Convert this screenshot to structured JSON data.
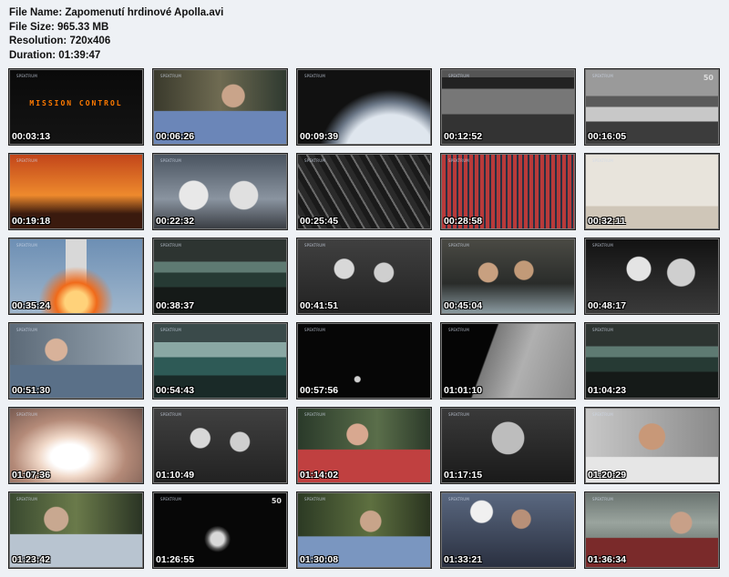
{
  "info": {
    "file_name": "File Name: Zapomenutí hrdinové Apolla.avi",
    "file_size": "File Size: 965.33 MB",
    "resolution": "Resolution: 720x406",
    "duration": "Duration: 01:39:47"
  },
  "channel_logo": "SPEKTRUM",
  "thumbnails": [
    {
      "time": "00:03:13",
      "scene": "title-mission-control",
      "overlay": "MISSION CONTROL"
    },
    {
      "time": "00:06:26",
      "scene": "interview-man-blue"
    },
    {
      "time": "00:09:39",
      "scene": "space-earth"
    },
    {
      "time": "00:12:52",
      "scene": "console-closeup"
    },
    {
      "time": "00:16:05",
      "scene": "control-room-bw",
      "badge": "50"
    },
    {
      "time": "00:19:18",
      "scene": "sunset-subtitle"
    },
    {
      "time": "00:22:32",
      "scene": "astronauts-suiting"
    },
    {
      "time": "00:25:45",
      "scene": "capsule-interior"
    },
    {
      "time": "00:28:58",
      "scene": "console-panel"
    },
    {
      "time": "00:32:11",
      "scene": "white-room"
    },
    {
      "time": "00:35:24",
      "scene": "rocket-launch"
    },
    {
      "time": "00:38:37",
      "scene": "control-room-color"
    },
    {
      "time": "00:41:51",
      "scene": "engineers-bw"
    },
    {
      "time": "00:45:04",
      "scene": "men-at-console"
    },
    {
      "time": "00:48:17",
      "scene": "headset-men"
    },
    {
      "time": "00:51:30",
      "scene": "interview-old-man"
    },
    {
      "time": "00:54:43",
      "scene": "control-room-wide"
    },
    {
      "time": "00:57:56",
      "scene": "dark-space"
    },
    {
      "time": "01:01:10",
      "scene": "moon-surface"
    },
    {
      "time": "01:04:23",
      "scene": "control-room-color"
    },
    {
      "time": "01:07:36",
      "scene": "launch-glare"
    },
    {
      "time": "01:10:49",
      "scene": "engineers-bw"
    },
    {
      "time": "01:14:02",
      "scene": "interview-man-red"
    },
    {
      "time": "01:17:15",
      "scene": "thinking-man-bw"
    },
    {
      "time": "01:20:29",
      "scene": "headset-man"
    },
    {
      "time": "01:23:42",
      "scene": "interview-garden"
    },
    {
      "time": "01:26:55",
      "scene": "spacecraft-dark",
      "badge": "50"
    },
    {
      "time": "01:30:08",
      "scene": "interview-garden-2"
    },
    {
      "time": "01:33:21",
      "scene": "crowd-sailors"
    },
    {
      "time": "01:36:34",
      "scene": "man-control-room"
    }
  ]
}
